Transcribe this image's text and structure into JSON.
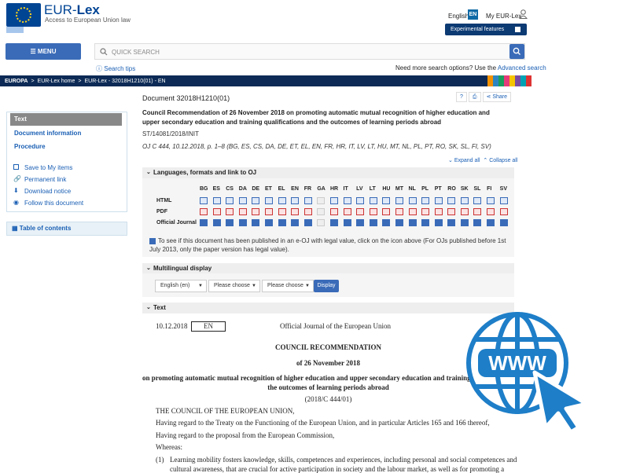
{
  "header": {
    "brand_pre": "EUR-",
    "brand_post": "Lex",
    "tagline": "Access to European Union law",
    "language": "English",
    "lang_code": "EN",
    "my_eurlex": "My EUR-Lex",
    "experimental": "Experimental features"
  },
  "nav": {
    "menu": "MENU",
    "search_placeholder": "QUICK SEARCH",
    "search_tips": "Search tips",
    "need_more": "Need more search options? Use the",
    "advanced": "Advanced search"
  },
  "breadcrumb": [
    "EUROPA",
    ">",
    "EUR-Lex home",
    ">",
    "EUR-Lex - 32018H1210(01) - EN"
  ],
  "stripe_colors": [
    "#f29100",
    "#2e86c1",
    "#1a9e5e",
    "#e63b7a",
    "#f6c500",
    "#7a4ca1",
    "#00a3b4",
    "#d33"
  ],
  "sidebar": {
    "text": "Text",
    "doc_info": "Document information",
    "procedure": "Procedure",
    "save": "Save to My items",
    "permalink": "Permanent link",
    "download": "Download notice",
    "follow": "Follow this document",
    "toc": "Table of contents"
  },
  "doc": {
    "id": "Document 32018H1210(01)",
    "help": "?",
    "share": "Share",
    "title": "Council Recommendation of 26 November 2018 on promoting automatic mutual recognition of higher education and upper secondary education and training qualifications and the outcomes of learning periods abroad",
    "st": "ST/14081/2018/INIT",
    "oj": "OJ C 444, 10.12.2018, p. 1–8 (BG, ES, CS, DA, DE, ET, EL, EN, FR, HR, IT, LV, LT, HU, MT, NL, PL, PT, RO, SK, SL, FI, SV)",
    "expand": "Expand all",
    "collapse": "Collapse all"
  },
  "languages": {
    "section": "Languages, formats and link to OJ",
    "codes": [
      "BG",
      "ES",
      "CS",
      "DA",
      "DE",
      "ET",
      "EL",
      "EN",
      "FR",
      "GA",
      "HR",
      "IT",
      "LV",
      "LT",
      "HU",
      "MT",
      "NL",
      "PL",
      "PT",
      "RO",
      "SK",
      "SL",
      "FI",
      "SV"
    ],
    "html": "HTML",
    "pdf": "PDF",
    "oj": "Official Journal",
    "note": "To see if this document has been published in an e-OJ with legal value, click on the icon above (For OJs published before 1st July 2013, only the paper version has legal value)."
  },
  "multilingual": {
    "section": "Multilingual display",
    "sel1": "English (en)",
    "sel2": "Please choose",
    "sel3": "Please choose",
    "display": "Display"
  },
  "text": {
    "section": "Text",
    "date": "10.12.2018",
    "lang": "EN",
    "oj_title": "Official Journal of the European Union",
    "heading": "COUNCIL RECOMMENDATION",
    "of": "of 26 November 2018",
    "subj1": "on promoting automatic mutual recognition of higher education and upper secondary education and training qualifications and",
    "subj2": "the outcomes of learning periods abroad",
    "ref": "(2018/C 444/01)",
    "council": "THE COUNCIL OF THE EUROPEAN UNION,",
    "p1": "Having regard to the Treaty on the Functioning of the European Union, and in particular Articles 165 and 166 thereof,",
    "p2": "Having regard to the proposal from the European Commission,",
    "p3": "Whereas:",
    "n1": "(1)",
    "r1": "Learning mobility fosters knowledge, skills, competences and experiences, including personal and social competences and",
    "r2": "cultural awareness, that are crucial for active participation in society and the labour market, as well as for promoting a"
  },
  "overlay": {
    "www": "WWW"
  }
}
